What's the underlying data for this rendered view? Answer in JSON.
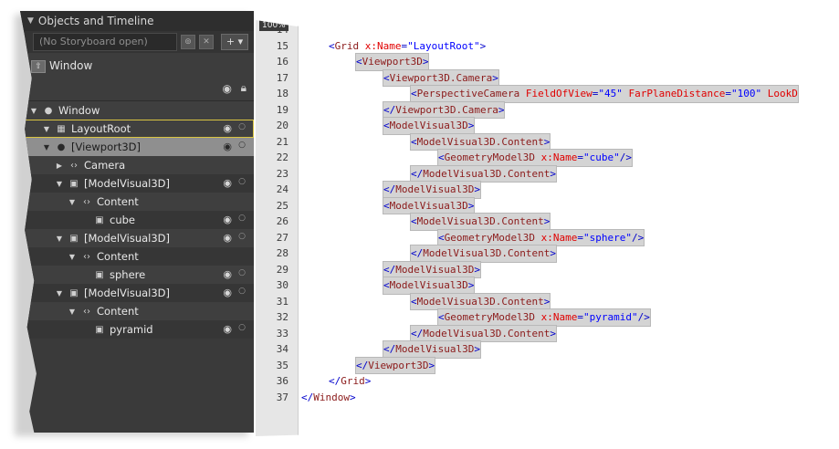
{
  "panel": {
    "title": "Objects and Timeline",
    "storyboard_placeholder": "(No Storyboard open)",
    "add_label": "+ ▾",
    "scope_label": "Window"
  },
  "tree": [
    {
      "label": "Window",
      "indent": 0,
      "expander": "▼",
      "icon": "●",
      "style": "odd",
      "eye": false,
      "dot": false
    },
    {
      "label": "LayoutRoot",
      "indent": 1,
      "expander": "▼",
      "icon": "▦",
      "style": "selected-outline",
      "eye": true,
      "dot": true
    },
    {
      "label": "[Viewport3D]",
      "indent": 1,
      "expander": "▼",
      "icon": "●",
      "style": "active",
      "eye": true,
      "dot": true
    },
    {
      "label": "Camera",
      "indent": 2,
      "expander": "▶",
      "icon": "‹›",
      "style": "odd",
      "eye": false,
      "dot": false
    },
    {
      "label": "[ModelVisual3D]",
      "indent": 2,
      "expander": "▼",
      "icon": "▣",
      "style": "even",
      "eye": true,
      "dot": true
    },
    {
      "label": "Content",
      "indent": 3,
      "expander": "▼",
      "icon": "‹›",
      "style": "odd",
      "eye": false,
      "dot": false
    },
    {
      "label": "cube",
      "indent": 4,
      "expander": "",
      "icon": "▣",
      "style": "even",
      "eye": true,
      "dot": true
    },
    {
      "label": "[ModelVisual3D]",
      "indent": 2,
      "expander": "▼",
      "icon": "▣",
      "style": "odd",
      "eye": true,
      "dot": true
    },
    {
      "label": "Content",
      "indent": 3,
      "expander": "▼",
      "icon": "‹›",
      "style": "even",
      "eye": false,
      "dot": false
    },
    {
      "label": "sphere",
      "indent": 4,
      "expander": "",
      "icon": "▣",
      "style": "odd",
      "eye": true,
      "dot": true
    },
    {
      "label": "[ModelVisual3D]",
      "indent": 2,
      "expander": "▼",
      "icon": "▣",
      "style": "even",
      "eye": true,
      "dot": true
    },
    {
      "label": "Content",
      "indent": 3,
      "expander": "▼",
      "icon": "‹›",
      "style": "odd",
      "eye": false,
      "dot": false
    },
    {
      "label": "pyramid",
      "indent": 4,
      "expander": "",
      "icon": "▣",
      "style": "even",
      "eye": true,
      "dot": true
    }
  ],
  "editor": {
    "zoom": "100%",
    "lines": [
      {
        "n": "14",
        "indent": 0,
        "tokens": [],
        "hl": false
      },
      {
        "n": "15",
        "indent": 1,
        "hl": false,
        "tokens": [
          [
            "br",
            "<"
          ],
          [
            "tag",
            "Grid "
          ],
          [
            "attr",
            "x:Name"
          ],
          [
            "eq",
            "="
          ],
          [
            "val",
            "\"LayoutRoot\""
          ],
          [
            "br",
            ">"
          ]
        ]
      },
      {
        "n": "16",
        "indent": 2,
        "hl": true,
        "tokens": [
          [
            "br",
            "<"
          ],
          [
            "tag",
            "Viewport3D"
          ],
          [
            "br",
            ">"
          ]
        ]
      },
      {
        "n": "17",
        "indent": 3,
        "hl": true,
        "tokens": [
          [
            "br",
            "<"
          ],
          [
            "tag",
            "Viewport3D.Camera"
          ],
          [
            "br",
            ">"
          ]
        ]
      },
      {
        "n": "18",
        "indent": 4,
        "hl": true,
        "tokens": [
          [
            "br",
            "<"
          ],
          [
            "tag",
            "PerspectiveCamera "
          ],
          [
            "attr",
            "FieldOfView"
          ],
          [
            "eq",
            "="
          ],
          [
            "val",
            "\"45\" "
          ],
          [
            "attr",
            "FarPlaneDistance"
          ],
          [
            "eq",
            "="
          ],
          [
            "val",
            "\"100\" "
          ],
          [
            "attr",
            "LookD"
          ]
        ]
      },
      {
        "n": "19",
        "indent": 3,
        "hl": true,
        "tokens": [
          [
            "br",
            "</"
          ],
          [
            "tag",
            "Viewport3D.Camera"
          ],
          [
            "br",
            ">"
          ]
        ]
      },
      {
        "n": "20",
        "indent": 3,
        "hl": true,
        "tokens": [
          [
            "br",
            "<"
          ],
          [
            "tag",
            "ModelVisual3D"
          ],
          [
            "br",
            ">"
          ]
        ]
      },
      {
        "n": "21",
        "indent": 4,
        "hl": true,
        "tokens": [
          [
            "br",
            "<"
          ],
          [
            "tag",
            "ModelVisual3D.Content"
          ],
          [
            "br",
            ">"
          ]
        ]
      },
      {
        "n": "22",
        "indent": 5,
        "hl": true,
        "tokens": [
          [
            "br",
            "<"
          ],
          [
            "tag",
            "GeometryModel3D "
          ],
          [
            "attr",
            "x:Name"
          ],
          [
            "eq",
            "="
          ],
          [
            "val",
            "\"cube\""
          ],
          [
            "br",
            "/>"
          ]
        ]
      },
      {
        "n": "23",
        "indent": 4,
        "hl": true,
        "tokens": [
          [
            "br",
            "</"
          ],
          [
            "tag",
            "ModelVisual3D.Content"
          ],
          [
            "br",
            ">"
          ]
        ]
      },
      {
        "n": "24",
        "indent": 3,
        "hl": true,
        "tokens": [
          [
            "br",
            "</"
          ],
          [
            "tag",
            "ModelVisual3D"
          ],
          [
            "br",
            ">"
          ]
        ]
      },
      {
        "n": "25",
        "indent": 3,
        "hl": true,
        "tokens": [
          [
            "br",
            "<"
          ],
          [
            "tag",
            "ModelVisual3D"
          ],
          [
            "br",
            ">"
          ]
        ]
      },
      {
        "n": "26",
        "indent": 4,
        "hl": true,
        "tokens": [
          [
            "br",
            "<"
          ],
          [
            "tag",
            "ModelVisual3D.Content"
          ],
          [
            "br",
            ">"
          ]
        ]
      },
      {
        "n": "27",
        "indent": 5,
        "hl": true,
        "tokens": [
          [
            "br",
            "<"
          ],
          [
            "tag",
            "GeometryModel3D "
          ],
          [
            "attr",
            "x:Name"
          ],
          [
            "eq",
            "="
          ],
          [
            "val",
            "\"sphere\""
          ],
          [
            "br",
            "/>"
          ]
        ]
      },
      {
        "n": "28",
        "indent": 4,
        "hl": true,
        "tokens": [
          [
            "br",
            "</"
          ],
          [
            "tag",
            "ModelVisual3D.Content"
          ],
          [
            "br",
            ">"
          ]
        ]
      },
      {
        "n": "29",
        "indent": 3,
        "hl": true,
        "tokens": [
          [
            "br",
            "</"
          ],
          [
            "tag",
            "ModelVisual3D"
          ],
          [
            "br",
            ">"
          ]
        ]
      },
      {
        "n": "30",
        "indent": 3,
        "hl": true,
        "tokens": [
          [
            "br",
            "<"
          ],
          [
            "tag",
            "ModelVisual3D"
          ],
          [
            "br",
            ">"
          ]
        ]
      },
      {
        "n": "31",
        "indent": 4,
        "hl": true,
        "tokens": [
          [
            "br",
            "<"
          ],
          [
            "tag",
            "ModelVisual3D.Content"
          ],
          [
            "br",
            ">"
          ]
        ]
      },
      {
        "n": "32",
        "indent": 5,
        "hl": true,
        "tokens": [
          [
            "br",
            "<"
          ],
          [
            "tag",
            "GeometryModel3D "
          ],
          [
            "attr",
            "x:Name"
          ],
          [
            "eq",
            "="
          ],
          [
            "val",
            "\"pyramid\""
          ],
          [
            "br",
            "/>"
          ]
        ]
      },
      {
        "n": "33",
        "indent": 4,
        "hl": true,
        "tokens": [
          [
            "br",
            "</"
          ],
          [
            "tag",
            "ModelVisual3D.Content"
          ],
          [
            "br",
            ">"
          ]
        ]
      },
      {
        "n": "34",
        "indent": 3,
        "hl": true,
        "tokens": [
          [
            "br",
            "</"
          ],
          [
            "tag",
            "ModelVisual3D"
          ],
          [
            "br",
            ">"
          ]
        ]
      },
      {
        "n": "35",
        "indent": 2,
        "hl": true,
        "tokens": [
          [
            "br",
            "</"
          ],
          [
            "tag",
            "Viewport3D"
          ],
          [
            "br",
            ">"
          ]
        ]
      },
      {
        "n": "36",
        "indent": 1,
        "hl": false,
        "tokens": [
          [
            "br",
            "</"
          ],
          [
            "tag",
            "Grid"
          ],
          [
            "br",
            ">"
          ]
        ]
      },
      {
        "n": "37",
        "indent": 0,
        "hl": false,
        "tokens": [
          [
            "br",
            "</"
          ],
          [
            "tag",
            "Window"
          ],
          [
            "br",
            ">"
          ]
        ]
      }
    ]
  }
}
